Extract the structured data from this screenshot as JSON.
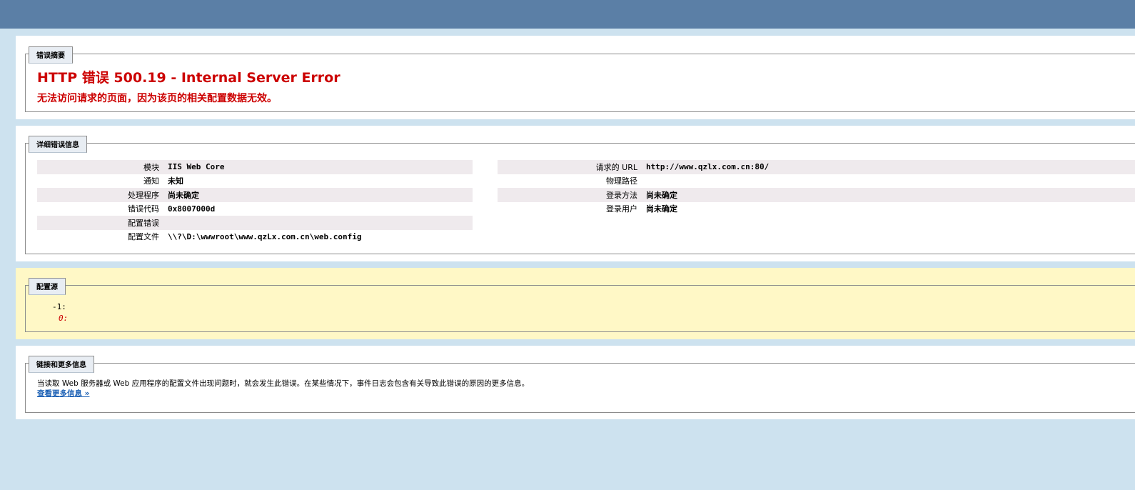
{
  "summary": {
    "legend": "错误摘要",
    "title": "HTTP 错误 500.19 - Internal Server Error",
    "subtitle": "无法访问请求的页面，因为该页的相关配置数据无效。"
  },
  "details": {
    "legend": "详细错误信息",
    "left": [
      {
        "label": "模块",
        "value": "IIS Web Core"
      },
      {
        "label": "通知",
        "value": "未知"
      },
      {
        "label": "处理程序",
        "value": "尚未确定"
      },
      {
        "label": "错误代码",
        "value": "0x8007000d"
      },
      {
        "label": "配置错误",
        "value": ""
      },
      {
        "label": "配置文件",
        "value": "\\\\?\\D:\\wwwroot\\www.qzLx.com.cn\\web.config"
      }
    ],
    "right": [
      {
        "label": "请求的 URL",
        "value": "http://www.qzlx.com.cn:80/"
      },
      {
        "label": "物理路径",
        "value": ""
      },
      {
        "label": "登录方法",
        "value": "尚未确定"
      },
      {
        "label": "登录用户",
        "value": "尚未确定"
      }
    ]
  },
  "config_source": {
    "legend": "配置源",
    "line_neg": "-1:",
    "line_zero": "0:"
  },
  "more_info": {
    "legend": "链接和更多信息",
    "text": "当读取 Web 服务器或 Web 应用程序的配置文件出现问题时，就会发生此错误。在某些情况下，事件日志会包含有关导致此错误的原因的更多信息。",
    "link": "查看更多信息 »"
  },
  "colors": {
    "header": "#5b7fa6",
    "background": "#cde2ef",
    "error_red": "#cc0000",
    "config_panel": "#fff8c6",
    "row_shade": "#efeaed"
  }
}
